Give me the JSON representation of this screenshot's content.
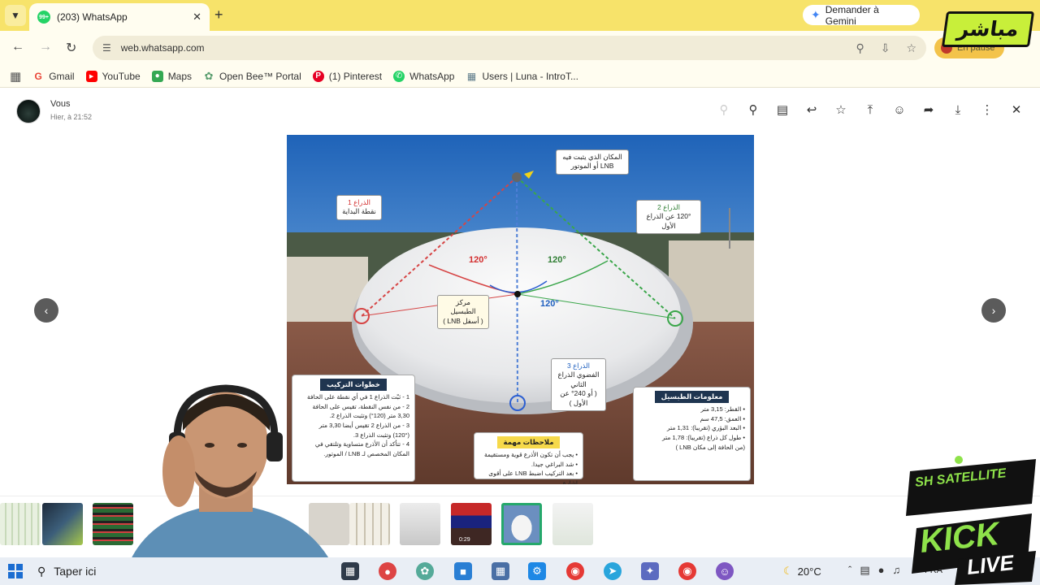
{
  "browser": {
    "tab_title": "(203) WhatsApp",
    "tab_badge": "99+",
    "gemini_label": "Demander à Gemini",
    "url": "web.whatsapp.com",
    "profile_label": "En pause"
  },
  "bookmarks": [
    {
      "label": "Gmail",
      "icon": "gmail-icon",
      "color": "#ea4335"
    },
    {
      "label": "YouTube",
      "icon": "youtube-icon",
      "color": "#ff0000"
    },
    {
      "label": "Maps",
      "icon": "maps-icon",
      "color": "#34a853"
    },
    {
      "label": "Open Bee™ Portal",
      "icon": "openbee-icon",
      "color": "#5a9e6f"
    },
    {
      "label": "(1) Pinterest",
      "icon": "pinterest-icon",
      "color": "#e60023"
    },
    {
      "label": "WhatsApp",
      "icon": "whatsapp-icon",
      "color": "#25d366"
    },
    {
      "label": "Users | Luna - IntroT...",
      "icon": "grid-icon",
      "color": "#607d8b"
    }
  ],
  "viewer": {
    "sender": "Vous",
    "time": "Hier, à 21:52"
  },
  "image": {
    "callout_lnb_line1": "المكان الذي يثبت فيه",
    "callout_lnb_line2": "LNB أو الموتور",
    "callout_arm1_line1": "الذراع 1",
    "callout_arm1_line2": "نقطة البداية",
    "callout_arm2_line1": "الذراع 2",
    "callout_arm2_line2": "120° عن الذراع الأول",
    "callout_center_line1": "مركز الطبسيل",
    "callout_center_line2": "( أسفل LNB )",
    "callout_arm3_line1": "الذراع 3",
    "callout_arm3_line2": "الفضوي الذراع الثاني",
    "callout_arm3_line3": "( أو 240° عن الأول )",
    "angle_a": "120°",
    "angle_b": "120°",
    "angle_c": "120°",
    "steps_title": "خطوات التركيب",
    "steps": [
      "1 - ثبّت الذراع 1 في أي نقطة على الحافة",
      "2 - من نفس النقطة، تقيس على الحافة",
      "3,30 متر (120°) وتثبت الذراع 2.",
      "3 - من الذراع 2 تقيس أيضا 3,30 متر",
      "(120°) وتثبت الذراع 3.",
      "4 - تتأكد أن الأذرع متساوية وتلتقي في",
      "المكان المخصص لـ LNB / الموتور."
    ],
    "notes_title": "ملاحظات مهمة",
    "notes": [
      "• يجب أن تكون الأذرع قوية ومستقيمة",
      "• شد البراغي جيدا.",
      "• بعد التركيب اضبط LNB على أقوى إشارة"
    ],
    "info_title": "معلومات الطبسيل",
    "info": [
      "• القطر: 3,15 متر",
      "• العمق: 47,5 سم",
      "• البعد البؤري (تقريبا): 1,31 متر",
      "• طول كل ذراع (تقريبا): 1,78 متر",
      "(من الحافة إلى مكان LNB )"
    ]
  },
  "thumbnails": {
    "video_duration": "0:29"
  },
  "taskbar": {
    "search_placeholder": "Taper ici",
    "temperature": "20°C",
    "language": "FRA"
  },
  "overlay": {
    "logo_top": "مباشر",
    "logo_brand": "SH SATELLITE",
    "logo_kick": "KICK",
    "logo_live": "LIVE"
  }
}
